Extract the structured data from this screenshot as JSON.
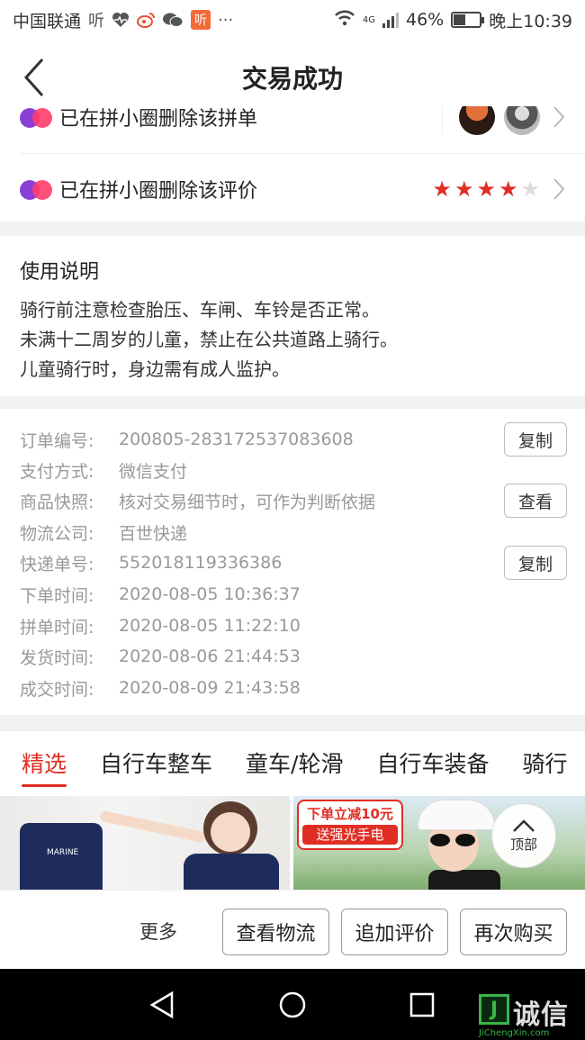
{
  "status_bar": {
    "carrier": "中国联通",
    "app_icons": [
      "ting-icon",
      "heart-pulse-icon",
      "weibo-icon",
      "wechat-icon",
      "ting-box-icon",
      "more-dots-icon"
    ],
    "ting_text": "听",
    "ting_box_text": "听",
    "more_dots": "···",
    "network_type": "4G",
    "battery_percent": "46%",
    "battery_level": 0.46,
    "time": "晚上10:39"
  },
  "header": {
    "title": "交易成功"
  },
  "reviews": [
    {
      "text": "已在拼小圈删除该拼单",
      "has_thumbnails": true
    },
    {
      "text": "已在拼小圈删除该评价",
      "rating": 4,
      "max_rating": 5
    }
  ],
  "instructions": {
    "title": "使用说明",
    "lines": [
      "骑行前注意检查胎压、车闸、车铃是否正常。",
      "未满十二周岁的儿童，禁止在公共道路上骑行。",
      "儿童骑行时，身边需有成人监护。"
    ]
  },
  "order_info": [
    {
      "label": "订单编号:",
      "value": "200805-283172537083608",
      "action": "复制"
    },
    {
      "label": "支付方式:",
      "value": "微信支付"
    },
    {
      "label": "商品快照:",
      "value": "核对交易细节时，可作为判断依据",
      "action": "查看"
    },
    {
      "label": "物流公司:",
      "value": "百世快递"
    },
    {
      "label": "快递单号:",
      "value": "552018119336386",
      "action": "复制"
    },
    {
      "label": "下单时间:",
      "value": "2020-08-05 10:36:37"
    },
    {
      "label": "拼单时间:",
      "value": "2020-08-05 11:22:10"
    },
    {
      "label": "发货时间:",
      "value": "2020-08-06 21:44:53"
    },
    {
      "label": "成交时间:",
      "value": "2020-08-09 21:43:58"
    }
  ],
  "tabs": [
    {
      "label": "精选",
      "active": true
    },
    {
      "label": "自行车整车"
    },
    {
      "label": "童车/轮滑"
    },
    {
      "label": "自行车装备"
    },
    {
      "label": "骑行"
    }
  ],
  "products": {
    "shirt_text": "MARINE",
    "promo_line1": "下单立减10元",
    "promo_line2": "送强光手电",
    "top_button_label": "顶部"
  },
  "actions": {
    "more": "更多",
    "view_logistics": "查看物流",
    "add_review": "追加评价",
    "buy_again": "再次购买"
  },
  "watermark": {
    "box_char": "J",
    "text": "诚信",
    "sub": "JiChengXin.com"
  },
  "colors": {
    "accent": "#e02e24",
    "muted_text": "#999999",
    "section_gap": "#f2f2f2"
  }
}
